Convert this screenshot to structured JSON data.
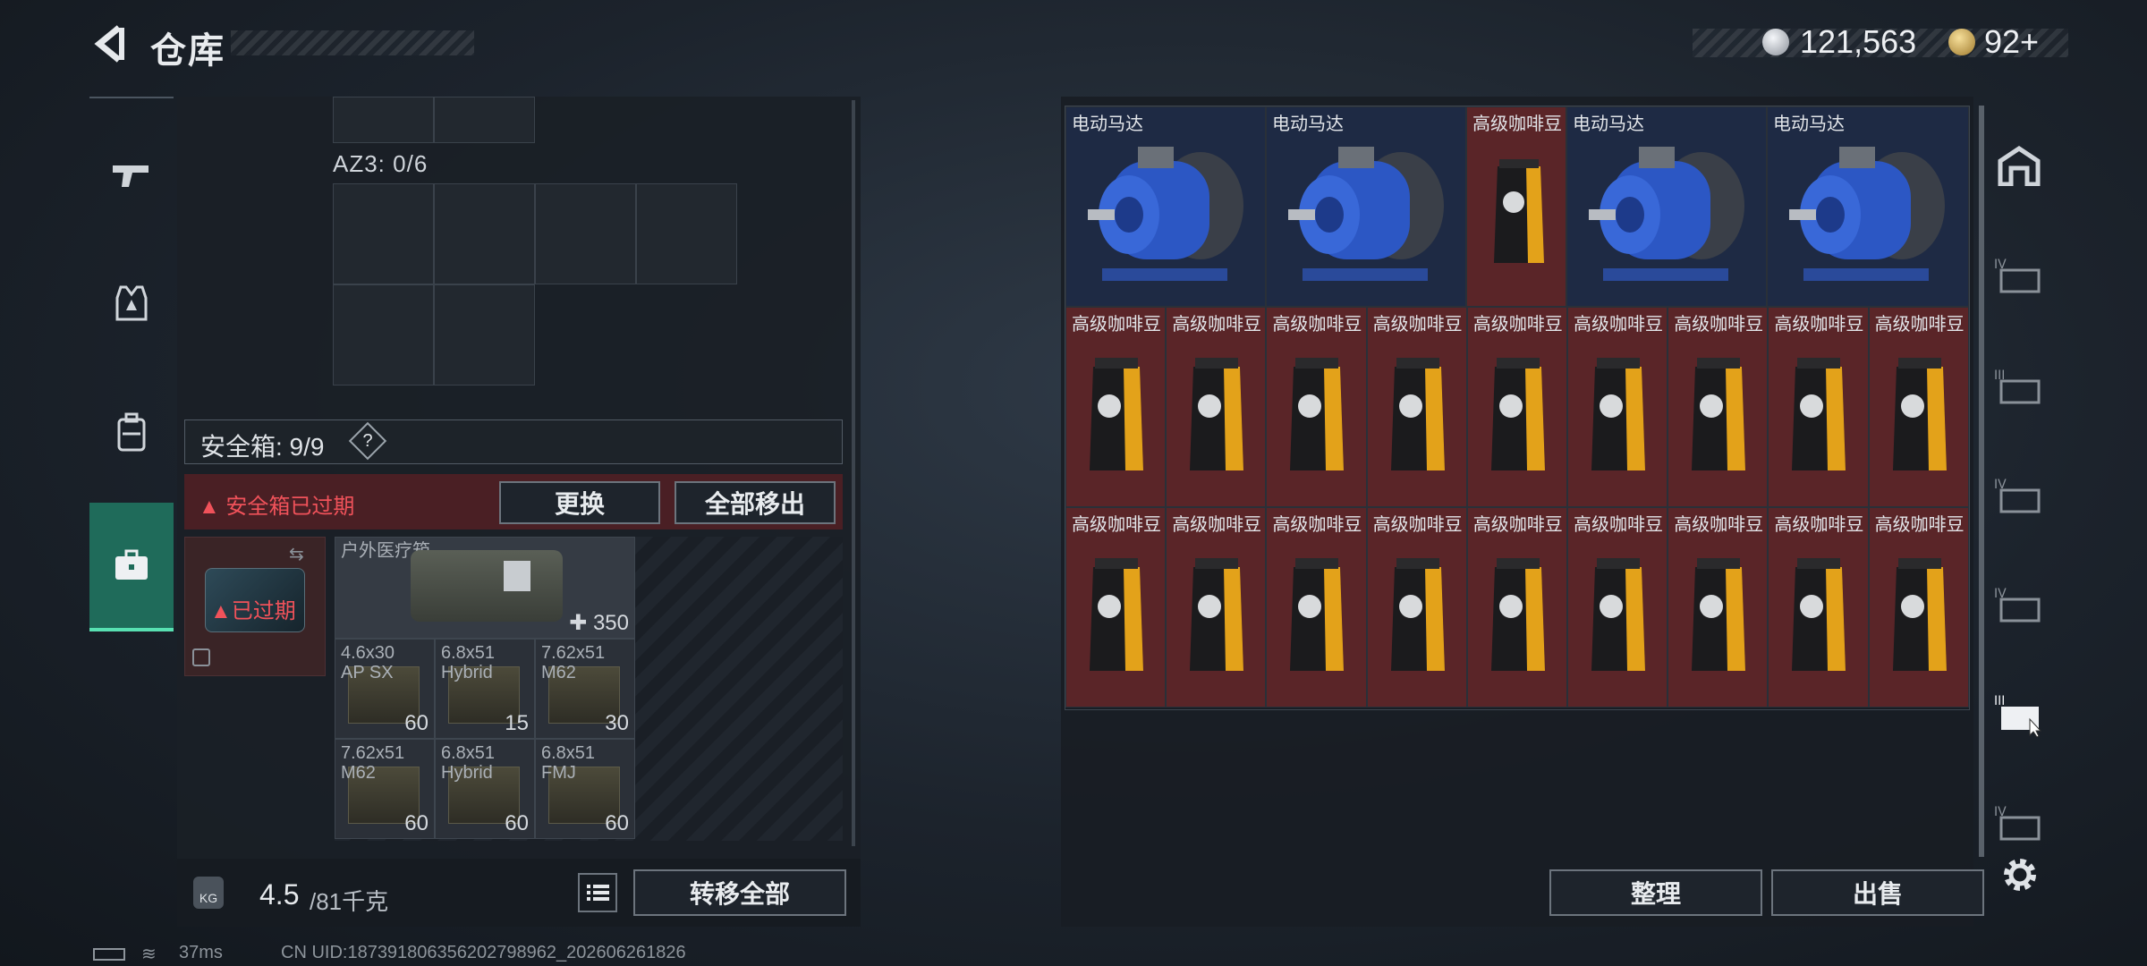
{
  "header": {
    "title": "仓库",
    "currency_a": "121,563",
    "currency_b": "92+"
  },
  "left_nav": {
    "items": [
      {
        "name": "weapon",
        "icon": "gun-icon"
      },
      {
        "name": "armor",
        "icon": "vest-icon"
      },
      {
        "name": "backpack",
        "icon": "backpack-icon"
      },
      {
        "name": "safebox",
        "icon": "briefcase-icon",
        "active": true
      }
    ]
  },
  "stash": {
    "az3_label": "AZ3: 0/6",
    "safebox_label": "安全箱: 9/9",
    "safebox_help": "?",
    "expired_warning": "安全箱已过期",
    "replace_button": "更换",
    "remove_all_button": "全部移出",
    "safebox_expired_badge": "已过期",
    "medkit": {
      "name": "户外医疗箱",
      "count": "350"
    },
    "ammo": [
      {
        "name": "4.6x30\nAP SX",
        "count": "60"
      },
      {
        "name": "6.8x51\nHybrid",
        "count": "15"
      },
      {
        "name": "7.62x51\nM62",
        "count": "30"
      },
      {
        "name": "7.62x51\nM62",
        "count": "60"
      },
      {
        "name": "6.8x51\nHybrid",
        "count": "60"
      },
      {
        "name": "6.8x51\nFMJ",
        "count": "60"
      }
    ],
    "weight_current": "4.5",
    "weight_rest": "/81千克",
    "transfer_all_button": "转移全部"
  },
  "inventory": {
    "row1": [
      {
        "label": "电动马达",
        "type": "motor"
      },
      {
        "label": "电动马达",
        "type": "motor"
      },
      {
        "label": "高级咖啡豆",
        "type": "coffee"
      },
      {
        "label": "电动马达",
        "type": "motor"
      },
      {
        "label": "电动马达",
        "type": "motor"
      }
    ],
    "coffee_label": "高级咖啡豆",
    "organize_button": "整理",
    "sell_button": "出售"
  },
  "status": {
    "ping": "37ms",
    "uid": "CN UID:187391806356202798962_202606261826"
  }
}
